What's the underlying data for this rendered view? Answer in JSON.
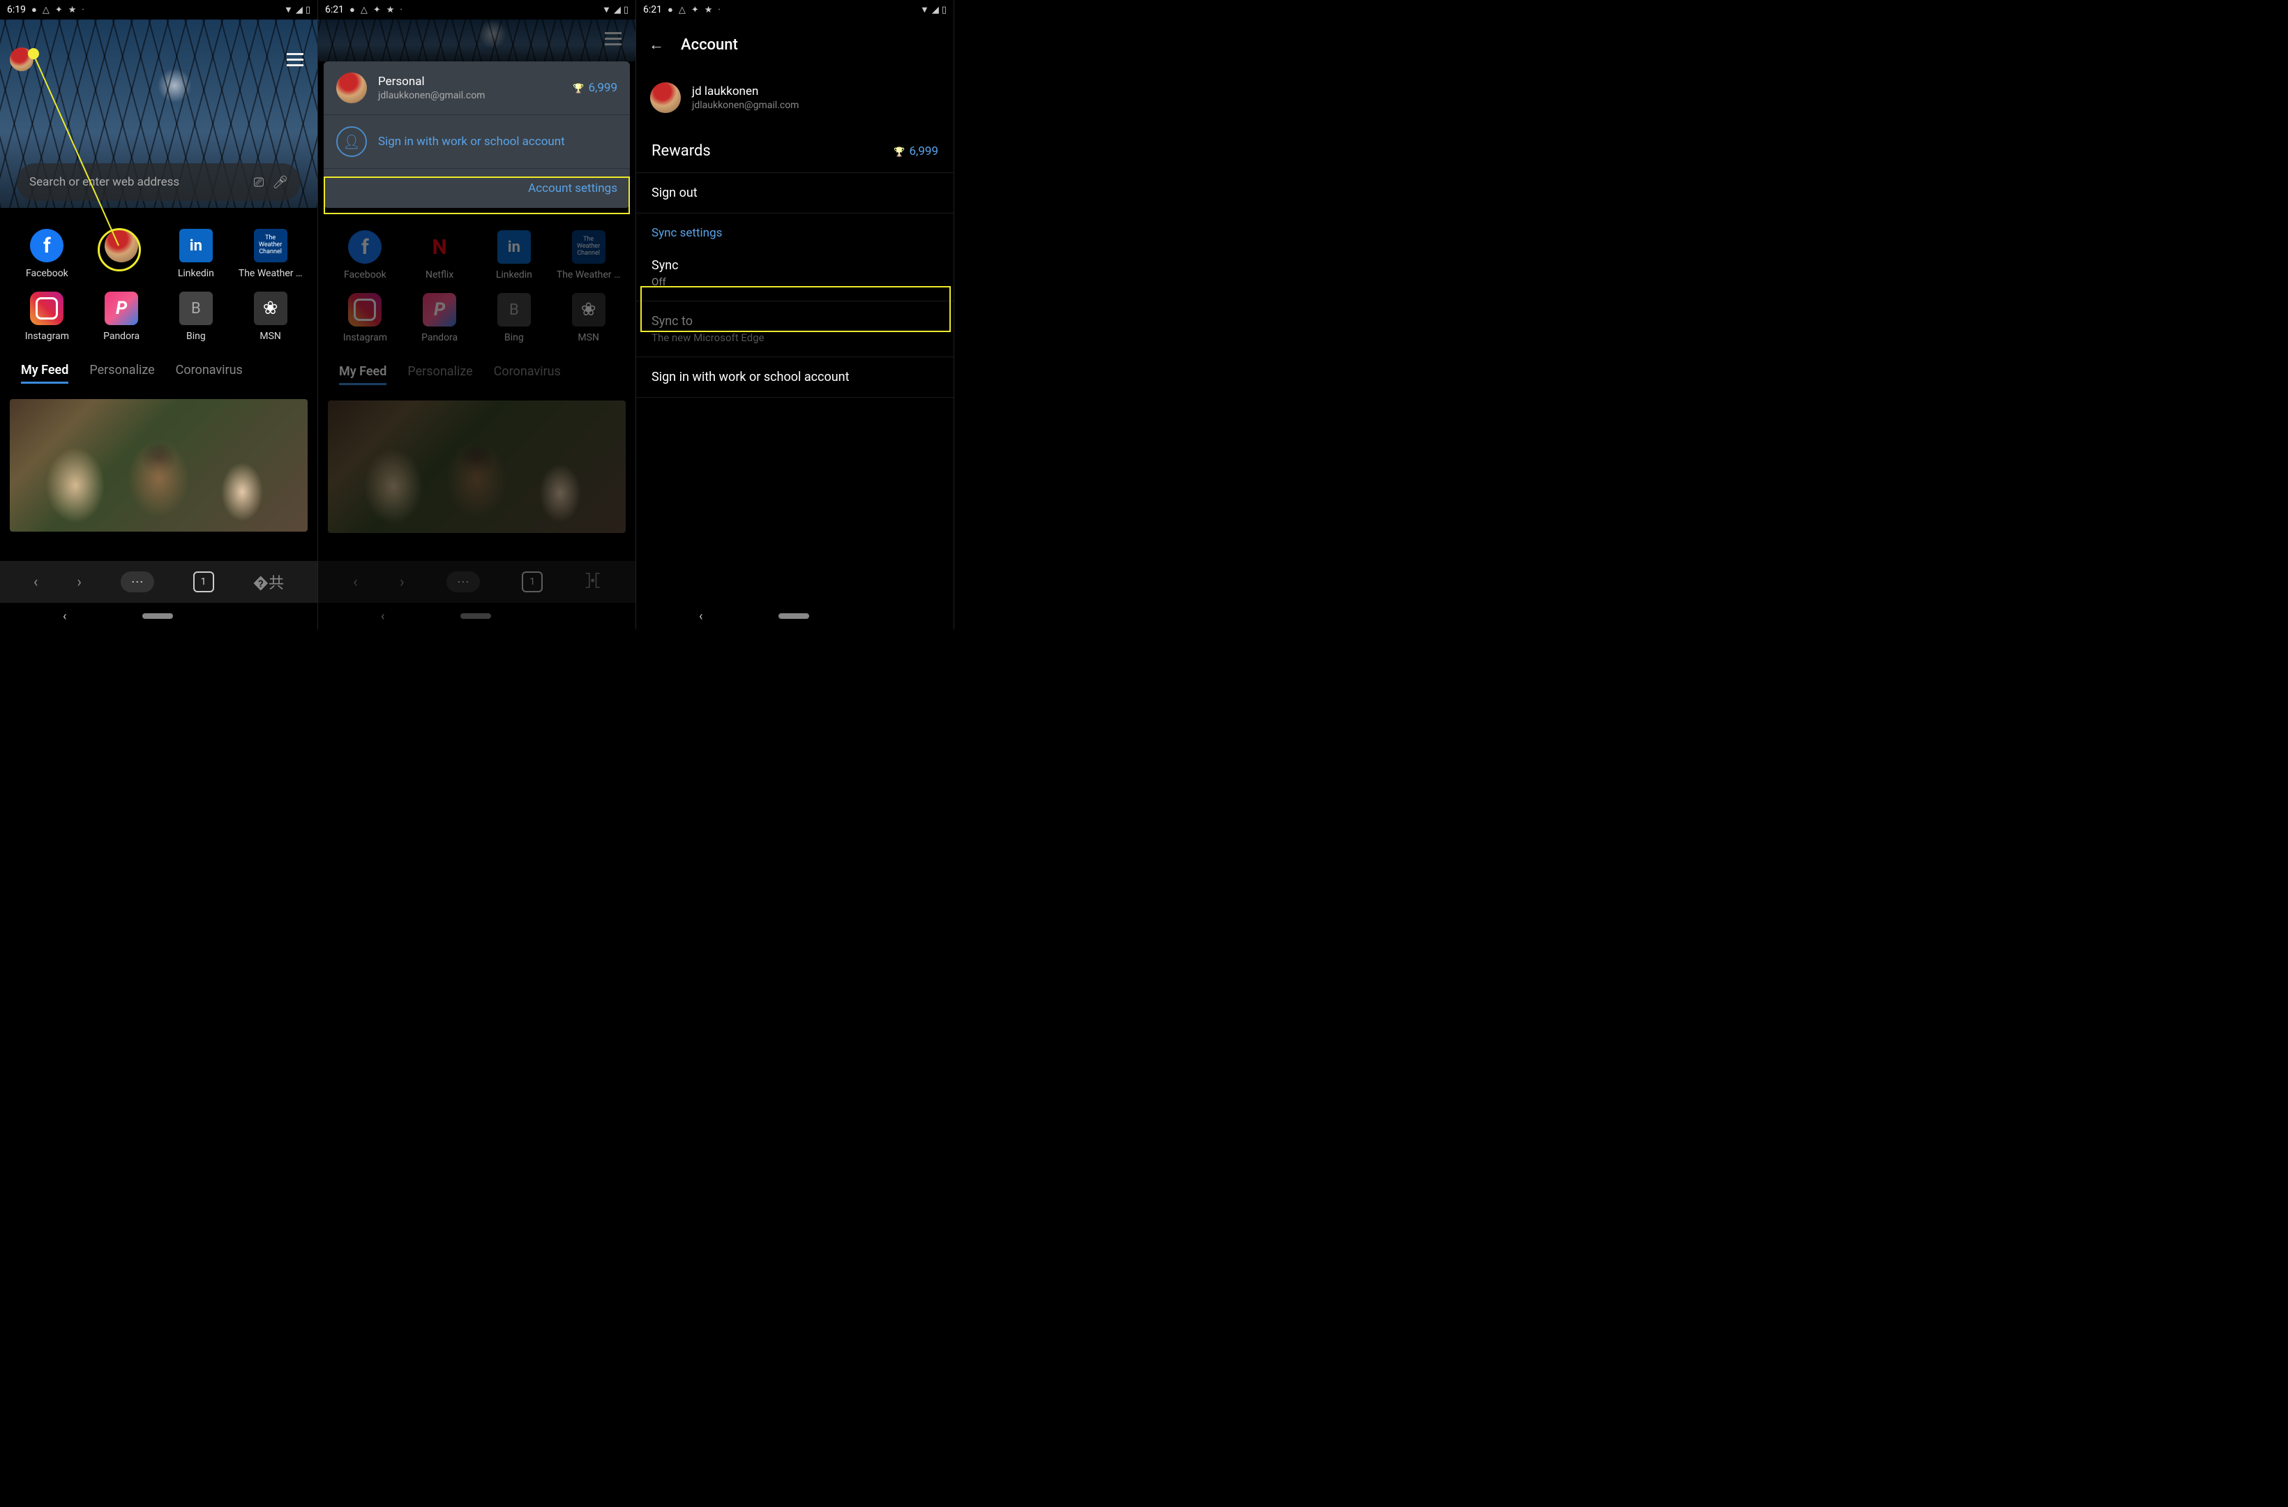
{
  "status": {
    "wifi": "▾",
    "signal": "◢",
    "battery": "🔋"
  },
  "screen1": {
    "time": "6:19",
    "search_placeholder": "Search or enter web address",
    "apps": [
      {
        "label": "Facebook"
      },
      {
        "label": ""
      },
      {
        "label": "Linkedin"
      },
      {
        "label": "The Weather …"
      },
      {
        "label": "Instagram"
      },
      {
        "label": "Pandora"
      },
      {
        "label": "Bing"
      },
      {
        "label": "MSN"
      }
    ],
    "tabs": [
      "My Feed",
      "Personalize",
      "Coronavirus"
    ],
    "tab_count": "1"
  },
  "screen2": {
    "time": "6:21",
    "panel": {
      "name": "Personal",
      "email": "jdlaukkonen@gmail.com",
      "rewards": "6,999",
      "work_label": "Sign in with work or school account",
      "account_settings": "Account settings"
    },
    "apps": [
      {
        "label": "Facebook"
      },
      {
        "label": "Netflix"
      },
      {
        "label": "Linkedin"
      },
      {
        "label": "The Weather …"
      },
      {
        "label": "Instagram"
      },
      {
        "label": "Pandora"
      },
      {
        "label": "Bing"
      },
      {
        "label": "MSN"
      }
    ],
    "tabs": [
      "My Feed",
      "Personalize",
      "Coronavirus"
    ],
    "tab_count": "1"
  },
  "screen3": {
    "time": "6:21",
    "title": "Account",
    "user_name": "jd laukkonen",
    "user_email": "jdlaukkonen@gmail.com",
    "rewards_label": "Rewards",
    "rewards_value": "6,999",
    "signout": "Sign out",
    "sync_settings": "Sync settings",
    "sync_label": "Sync",
    "sync_value": "Off",
    "syncto_label": "Sync to",
    "syncto_value": "The new Microsoft Edge",
    "work_signin": "Sign in with work or school account"
  }
}
